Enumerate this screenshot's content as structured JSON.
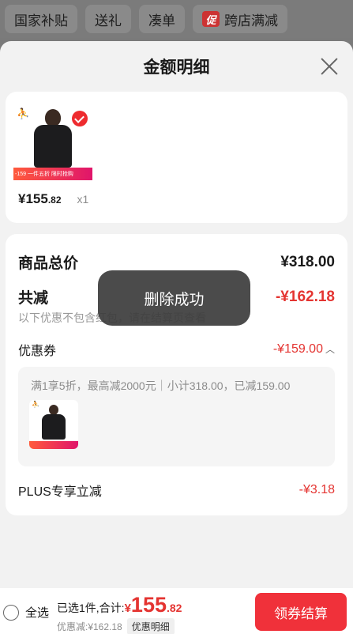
{
  "tagbar": {
    "tags": [
      "国家补贴",
      "送礼",
      "凑单",
      "跨店满减"
    ],
    "promo_badge": "促"
  },
  "sheet": {
    "title": "金额明细"
  },
  "product": {
    "brand_logo": "jumpman-logo-icon",
    "price_int": "¥155",
    "price_dec": ".82",
    "quantity": "x1",
    "image_banner_price": "-159",
    "image_banner_text": "一件五折 限时抢购"
  },
  "summary": {
    "total_label": "商品总价",
    "total_value": "¥318.00",
    "reduce_label": "共减",
    "reduce_value": "-¥162.18",
    "note": "以下优惠不包含红包，请在结算页查看",
    "coupon_label": "优惠券",
    "coupon_value": "-¥159.00",
    "coupon_desc": "满1享5折，最高减2000元｜小计318.00，已减159.00",
    "mini_banner_price": "-159",
    "mini_banner_text": "一件五折 限时抢购",
    "plus_label": "PLUS专享立减",
    "plus_value": "-¥3.18"
  },
  "toast": {
    "text": "删除成功"
  },
  "bottom": {
    "select_all_label": "全选",
    "sum_text": "已选1件,合计:",
    "sum_currency": "¥",
    "sum_int": "155",
    "sum_dec": ".82",
    "discount_text": "优惠减:¥162.18",
    "detail_button": "优惠明细",
    "checkout_button": "领券结算"
  },
  "colors": {
    "accent_red": "#e43431",
    "checkout_bg": "#f0313a"
  }
}
